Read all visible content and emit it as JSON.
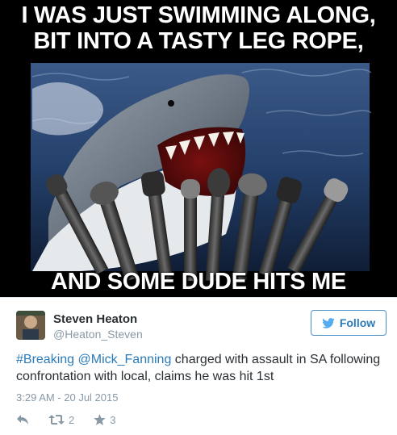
{
  "meme": {
    "caption_line1": "I WAS JUST SWIMMING ALONG,",
    "caption_line2": "BIT INTO A TASTY LEG ROPE,",
    "caption_bottom": "AND SOME DUDE HITS ME"
  },
  "tweet": {
    "author_name": "Steven Heaton",
    "author_handle": "@Heaton_Steven",
    "follow_label": "Follow",
    "text_hashtag": "#Breaking",
    "text_mention": "@Mick_Fanning",
    "text_rest": " charged with assault in SA following confrontation with local, claims he was hit 1st",
    "timestamp": "3:29 AM - 20 Jul 2015",
    "retweet_count": "2",
    "favorite_count": "3"
  },
  "colors": {
    "link": "#2b7bb9",
    "text": "#292f33",
    "muted": "#8899a6"
  },
  "icons": [
    "reply-icon",
    "retweet-icon",
    "star-icon",
    "twitter-bird-icon"
  ]
}
